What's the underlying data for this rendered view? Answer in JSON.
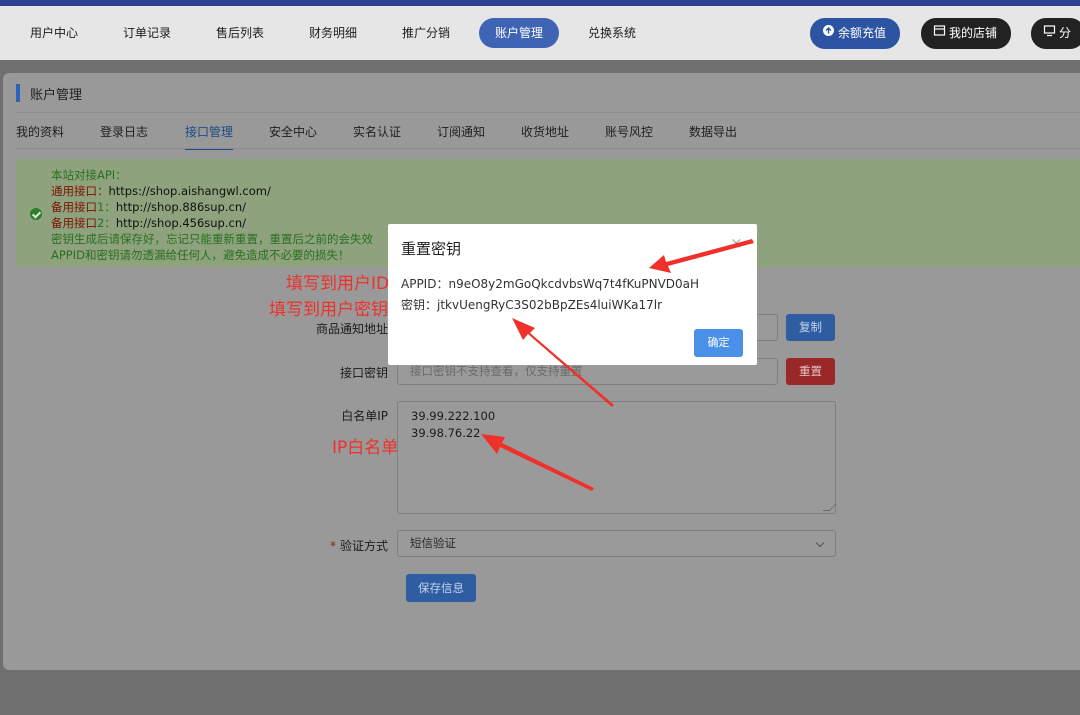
{
  "nav": {
    "items": [
      {
        "label": "用户中心"
      },
      {
        "label": "订单记录"
      },
      {
        "label": "售后列表"
      },
      {
        "label": "财务明细"
      },
      {
        "label": "推广分销"
      },
      {
        "label": "账户管理",
        "active": true
      },
      {
        "label": "兑换系统"
      }
    ],
    "recharge_label": "余额充值",
    "shop_label": "我的店铺",
    "share_label": "分"
  },
  "page": {
    "title": "账户管理"
  },
  "tabs": [
    {
      "label": "我的资料"
    },
    {
      "label": "登录日志"
    },
    {
      "label": "接口管理",
      "active": true
    },
    {
      "label": "安全中心"
    },
    {
      "label": "实名认证"
    },
    {
      "label": "订阅通知"
    },
    {
      "label": "收货地址"
    },
    {
      "label": "账号风控"
    },
    {
      "label": "数据导出"
    }
  ],
  "notice": {
    "line1": "本站对接API：",
    "line2_label": "通用接口：",
    "line2_url": "https://shop.aishangwl.com/",
    "line3_label": "备用接口",
    "line3_num": "1：",
    "line3_url": "http://shop.886sup.cn/",
    "line4_label": "备用接口",
    "line4_num": "2：",
    "line4_url": "http://shop.456sup.cn/",
    "line5": "密钥生成后请保存好，忘记只能重新重置，重置后之前的会失效",
    "line6": "APPID和密钥请勿透漏给任何人，避免造成不必要的损失！"
  },
  "form": {
    "notify_label": "商品通知地址",
    "copy_button": "复制",
    "secret_label": "接口密钥",
    "secret_placeholder": "接口密钥不支持查看，仅支持重置",
    "reset_button": "重置",
    "whitelist_label": "白名单IP",
    "whitelist_ips": [
      "39.99.222.100",
      "39.98.76.22"
    ],
    "verify_label": "验证方式",
    "verify_value": "短信验证",
    "save_button": "保存信息"
  },
  "dialog": {
    "title": "重置密钥",
    "close": "×",
    "appid_label": "APPID：",
    "appid_value": "n9eO8y2mGoQkcdvbsWq7t4fKuPNVD0aH",
    "secret_label": "密钥：",
    "secret_value": "jtkvUengRyC3S02bBpZEs4luiWKa17lr",
    "ok_button": "确定"
  },
  "annotations": {
    "appid_note": "填写到用户ID",
    "secret_note": "填写到用户密钥",
    "ip_note": "IP白名单"
  },
  "colors": {
    "nav_active": "#3f64b5",
    "recharge_btn": "#2d54a3",
    "dark_btn": "#222222",
    "dialog_ok": "#4a90e8",
    "annotation_red": "#f0302a"
  }
}
